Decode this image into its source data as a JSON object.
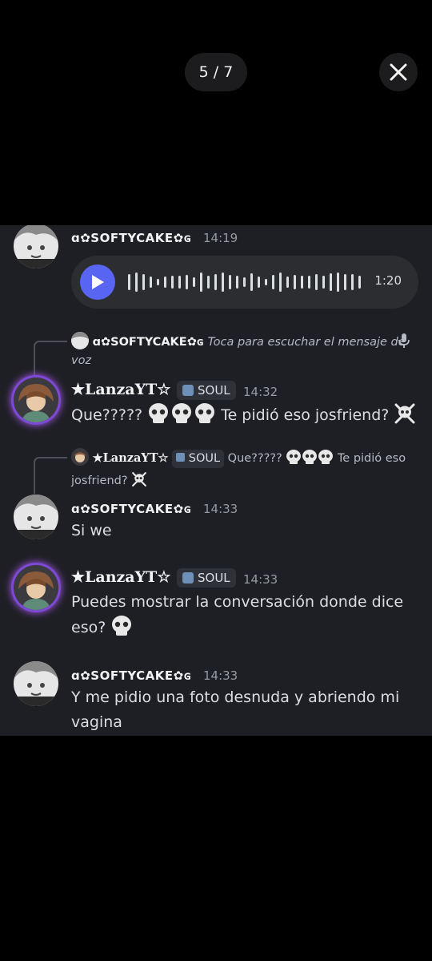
{
  "viewer": {
    "counter": "5 / 7",
    "close_icon": "close-icon"
  },
  "users": {
    "softy": "ȡ✿ｓｏｆｔｙｃａｋｅ✿ɢ",
    "softy_display": "ɑ✿SOFTYCAKE✿ɢ",
    "lanza": "★LanzaYT☆"
  },
  "badge": {
    "label": "SOUL",
    "icon": "shield-badge-icon"
  },
  "messages": [
    {
      "user": "ɑ✿SOFTYCAKE✿ɢ",
      "time": "14:19",
      "type": "voice",
      "duration": "1:20"
    },
    {
      "reply_user": "ɑ✿SOFTYCAKE✿ɢ",
      "reply_text": "Toca para escuchar el mensaje de voz",
      "user": "★LanzaYT☆",
      "badge": "SOUL",
      "time": "14:32",
      "text": "Que?????",
      "text_after": "Te pidió eso josfriend?"
    },
    {
      "reply_user": "★LanzaYT☆",
      "reply_badge": "SOUL",
      "reply_text": "Que?????",
      "reply_after": "Te pidió eso",
      "reply_wrap": "josfriend?",
      "user": "ɑ✿SOFTYCAKE✿ɢ",
      "time": "14:33",
      "text": "Si we"
    },
    {
      "user": "★LanzaYT☆",
      "badge": "SOUL",
      "time": "14:33",
      "text": "Puedes mostrar la conversación donde dice",
      "text2": "eso?"
    },
    {
      "user": "ɑ✿SOFTYCAKE✿ɢ",
      "time": "14:33",
      "text": "Y me pidio una foto desnuda y abriendo mi",
      "text2": "vagina"
    }
  ],
  "colors": {
    "background": "#000000",
    "chat_bg": "#1e1f24",
    "accent": "#5865f2",
    "lanza_ring": "#b05cff"
  }
}
